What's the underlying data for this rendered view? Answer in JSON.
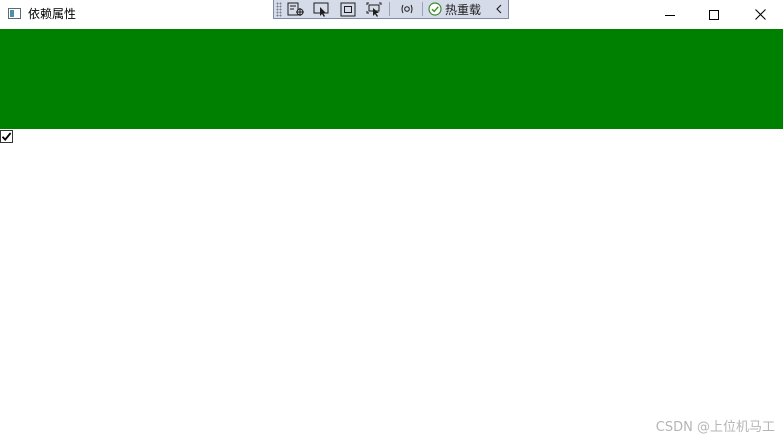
{
  "window": {
    "title": "依赖属性"
  },
  "debug_toolbar": {
    "hot_reload_label": "热重载",
    "icons": [
      "select-element-icon",
      "toggle-selection-icon",
      "display-adorners-icon",
      "track-focus-icon",
      "binding-failures-icon",
      "hot-reload-check-icon",
      "collapse-chevron-icon"
    ]
  },
  "content": {
    "panel_color": "#008000",
    "checkbox_checked": true
  },
  "watermark": {
    "text": "CSDN @上位机马工"
  }
}
